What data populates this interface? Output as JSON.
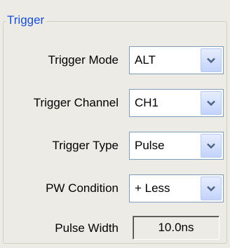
{
  "group": {
    "title": "Trigger"
  },
  "fields": [
    {
      "label": "Trigger Mode",
      "value": "ALT"
    },
    {
      "label": "Trigger Channel",
      "value": "CH1"
    },
    {
      "label": "Trigger Type",
      "value": "Pulse"
    },
    {
      "label": "PW Condition",
      "value": "+ Less"
    }
  ],
  "pulse_width": {
    "label": "Pulse Width",
    "value": "10.0ns"
  },
  "icons": {
    "dropdown": "chevron-down-icon"
  },
  "colors": {
    "group_title": "#1a4fd6",
    "background": "#ecebe6",
    "combo_border": "#7f9db9"
  }
}
